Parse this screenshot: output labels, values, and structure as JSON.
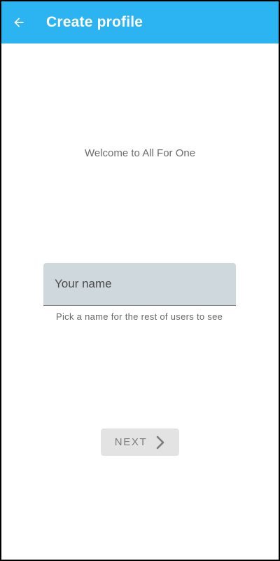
{
  "app_bar": {
    "title": "Create profile",
    "back_icon": "arrow-left-icon",
    "color": "#2cb4f2"
  },
  "main": {
    "welcome_text": "Welcome to All For One",
    "name_field": {
      "placeholder": "Your name",
      "value": "",
      "helper_text": "Pick a name for the rest of users to see"
    },
    "next_button": {
      "label": "NEXT",
      "icon": "chevron-right-icon",
      "enabled": false
    }
  }
}
